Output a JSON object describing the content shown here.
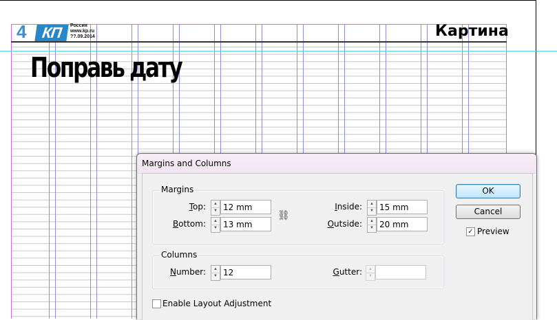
{
  "page": {
    "page_number": "4",
    "logo_text": "КП",
    "logo_meta": [
      "Россия",
      "www.kp.ru",
      "??.09.2014"
    ],
    "section_title": "Картина",
    "headline": "Поправь дату"
  },
  "dialog": {
    "title": "Margins and Columns",
    "margins": {
      "group_label": "Margins",
      "top_label": "Top:",
      "top_value": "12 mm",
      "bottom_label": "Bottom:",
      "bottom_value": "13 mm",
      "inside_label": "Inside:",
      "inside_value": "15 mm",
      "outside_label": "Outside:",
      "outside_value": "20 mm"
    },
    "columns": {
      "group_label": "Columns",
      "number_label": "Number:",
      "number_value": "12",
      "gutter_label": "Gutter:",
      "gutter_value": ""
    },
    "enable_layout_adjustment": {
      "label": "Enable Layout Adjustment",
      "checked": false
    },
    "buttons": {
      "ok": "OK",
      "cancel": "Cancel"
    },
    "preview": {
      "label": "Preview",
      "checked": true,
      "mark": "✓"
    },
    "chain_icon": "⛓"
  },
  "colors": {
    "column_guides": "#8a8fd6",
    "baseline_grid": "#c9c9c9",
    "margin_guides": "#c86fd6",
    "ruler_guide": "#5cd3dc",
    "logo": "#2a86c9"
  }
}
